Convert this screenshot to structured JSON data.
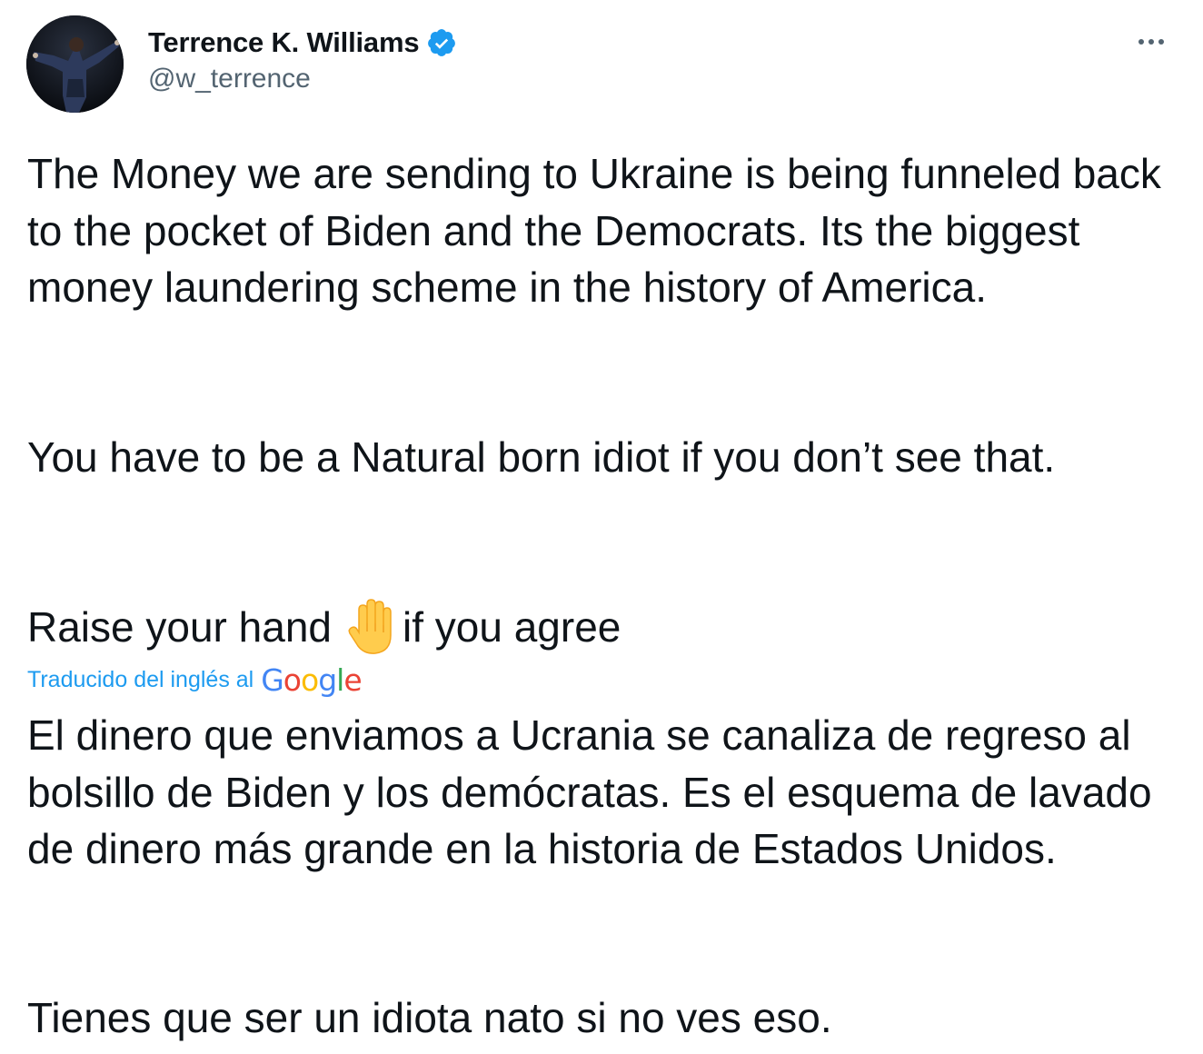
{
  "author": {
    "display_name": "Terrence K. Williams",
    "handle": "@w_terrence",
    "verified": true,
    "verified_color": "#1d9bf0"
  },
  "more_menu": {
    "icon": "more-dots-icon"
  },
  "tweet": {
    "original_paragraph_1": "The Money we are sending to Ukraine is being funneled back to the pocket of Biden and the Democrats. Its the biggest money laundering scheme in the history of America.",
    "original_paragraph_2": "You have to be a Natural born idiot if you don’t see that.",
    "original_paragraph_3_before": "Raise your hand",
    "original_paragraph_3_emoji": "raised-hand-icon",
    "original_paragraph_3_after": "if you agree",
    "translation_label": "Traducido del inglés al",
    "translation_provider": {
      "letters": [
        "G",
        "o",
        "o",
        "g",
        "l",
        "e"
      ],
      "colors": [
        "#4285f4",
        "#ea4335",
        "#fbbc05",
        "#4285f4",
        "#34a853",
        "#ea4335"
      ]
    },
    "translated_paragraph_1": "El dinero que enviamos a Ucrania se canaliza de regreso al bolsillo de Biden y los demócratas. Es el esquema de lavado de dinero más grande en la historia de Estados Unidos.",
    "translated_paragraph_2": "Tienes que ser un idiota nato si no ves eso."
  }
}
